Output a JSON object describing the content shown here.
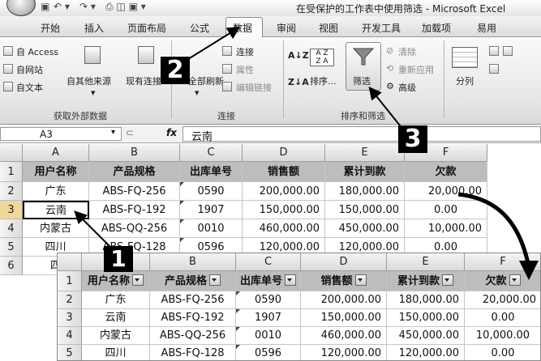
{
  "window": {
    "title": "在受保护的工作表中使用筛选 - Microsoft Excel"
  },
  "ribbon_tabs": [
    "开始",
    "插入",
    "页面布局",
    "公式",
    "数据",
    "审阅",
    "视图",
    "开发工具",
    "加载项",
    "易用"
  ],
  "active_tab": "数据",
  "groups": {
    "external": {
      "label": "获取外部数据",
      "items": [
        "自 Access",
        "自网站",
        "自文本"
      ],
      "other_sources": "自其他来源",
      "existing": "现有连接"
    },
    "connections": {
      "label": "连接",
      "refresh": "全部刷新",
      "items": [
        "连接",
        "属性",
        "编辑链接"
      ]
    },
    "sort_filter": {
      "label": "排序和筛选",
      "az": "A↓Z",
      "za": "Z↓A",
      "sort": "排序...",
      "filter": "筛选",
      "clear": "清除",
      "reapply": "重新应用",
      "advanced": "高级"
    },
    "tools": {
      "split": "分列"
    }
  },
  "formula_bar": {
    "name_box": "A3",
    "fx": "fx",
    "value": "云南"
  },
  "columns": [
    "A",
    "B",
    "C",
    "D",
    "E",
    "F"
  ],
  "headers": [
    "用户名称",
    "产品规格",
    "出库单号",
    "销售额",
    "累计到款",
    "欠款"
  ],
  "front_headers": [
    "用户名称",
    "产品规格",
    "出库单号",
    "销售额",
    "累计到款",
    "欠款"
  ],
  "rows": [
    {
      "n": "2",
      "cells": [
        "广东",
        "ABS-FQ-256",
        "0590",
        "200,000.00",
        "180,000.00",
        "20,000.00"
      ]
    },
    {
      "n": "3",
      "cells": [
        "云南",
        "ABS-FQ-192",
        "1907",
        "150,000.00",
        "150,000.00",
        "0.00"
      ]
    },
    {
      "n": "4",
      "cells": [
        "内蒙古",
        "ABS-QQ-256",
        "0010",
        "460,000.00",
        "450,000.00",
        "10,000.00"
      ]
    },
    {
      "n": "5",
      "cells": [
        "四川",
        "ABS-FQ-128",
        "0596",
        "120,000.00",
        "120,000.00",
        "0.00"
      ]
    },
    {
      "n": "6",
      "cells": [
        "四",
        "",
        "",
        "",
        "",
        ""
      ]
    }
  ],
  "callouts": [
    "1",
    "2",
    "3"
  ],
  "colors": {
    "header_fill": "#bdbdbd",
    "badge": "#000000"
  }
}
